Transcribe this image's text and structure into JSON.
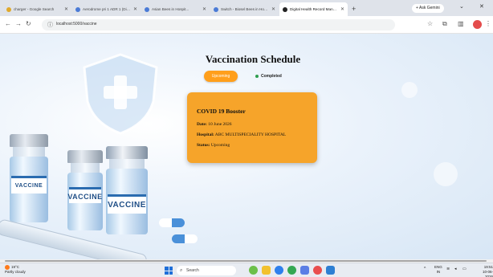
{
  "browser": {
    "tabs": [
      {
        "title": "charger - Google Search",
        "active": false,
        "favicon_color": "#e0a92b"
      },
      {
        "title": "Aerodrome pri 1 ADR 1 (Digam...",
        "active": false,
        "favicon_color": "#4b7bd6"
      },
      {
        "title": "Asian Bees in Hospit...",
        "active": false,
        "favicon_color": "#4b7bd6"
      },
      {
        "title": "Switch - Biosel Bees in Hospi...",
        "active": false,
        "favicon_color": "#4b7bd6"
      },
      {
        "title": "Digital Health Record Manage...",
        "active": true,
        "favicon_color": "#222222"
      }
    ],
    "new_tab_label": "+",
    "ask_gemini_label": "+ Ask Gemini",
    "url": "localhost:5000/vaccine"
  },
  "page": {
    "title": "Vaccination Schedule",
    "tabs": {
      "upcoming_label": "Upcoming",
      "completed_label": "Completed"
    },
    "card": {
      "title": "COVID 19 Booster",
      "date_label": "Date:",
      "date_value": "10 June 2026",
      "hospital_label": "Hospital:",
      "hospital_value": "ABC MULTISPECIALITY HOSPITAL",
      "status_label": "Status:",
      "status_value": "Upcoming"
    },
    "vial_labels": [
      "VACCINE",
      "VACCINE",
      "VACCINE"
    ]
  },
  "taskbar": {
    "weather_temp": "19°C",
    "weather_desc": "Partly cloudy",
    "search_placeholder": "Search",
    "lang_line1": "ENG",
    "lang_line2": "IN",
    "time": "19:51",
    "date": "10-06-2026"
  },
  "colors": {
    "accent_orange": "#ff9f1c",
    "card_orange": "#f6a42a",
    "completed_dot": "#2e9e4f"
  }
}
